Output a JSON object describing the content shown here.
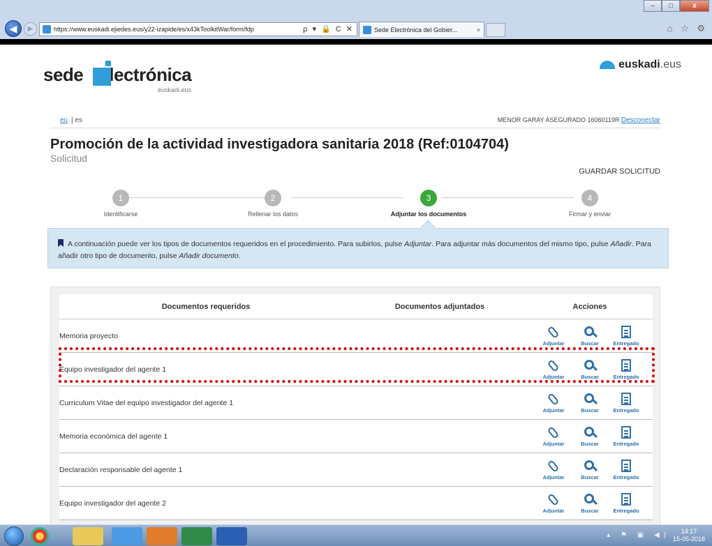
{
  "browser": {
    "url": "https://www.euskadi.ejiedes.eus/y22-izapide/es/x43kToolkitWar/form/fdp",
    "url_actions": "ρ ▾ 🔒 C ✕",
    "tab_title": "Sede Electrónica del Gobier...",
    "tab_close": "×",
    "win_min": "–",
    "win_max": "□",
    "win_close": "x",
    "chrome_icons": "⌂ ☆ ⚙"
  },
  "header": {
    "logo_sede": "sede",
    "logo_elec": "lectrónica",
    "logo_sub": "euskadi.eus",
    "euskadi_bold": "euskadi",
    "euskadi_ext": ".eus"
  },
  "langbar": {
    "lang_eu": "eu",
    "lang_sep": "| es",
    "user": "MENOR GARAY ASEGURADO 16060119R",
    "logout": "Desconectar"
  },
  "page": {
    "title": "Promoción de la actividad investigadora sanitaria 2018 (Ref:0104704)",
    "subtitle": "Solicitud",
    "save": "GUARDAR SOLICITUD"
  },
  "steps": [
    {
      "num": "1",
      "label": "Identificarse"
    },
    {
      "num": "2",
      "label": "Rellenar los datos"
    },
    {
      "num": "3",
      "label": "Adjuntar los documentos"
    },
    {
      "num": "4",
      "label": "Firmar y enviar"
    }
  ],
  "info": {
    "text1": "A continuación puede ver los tipos de documentos requeridos en el procedimiento. Para subirlos, pulse ",
    "em1": "Adjuntar",
    "text2": ". Para adjuntar más documentos del mismo tipo, pulse ",
    "em2": "Añadir",
    "text3": ". Para añadir otro tipo de documento, pulse ",
    "em3": "Añadir documento",
    "text4": "."
  },
  "table": {
    "headers": {
      "required": "Documentos requeridos",
      "attached": "Documentos adjuntados",
      "actions": "Acciones"
    },
    "action_labels": {
      "attach": "Adjuntar",
      "search": "Buscar",
      "delivered": "Entregado"
    },
    "rows": [
      {
        "name": "Memoria proyecto"
      },
      {
        "name": "Equipo investigador del agente 1"
      },
      {
        "name": "Curriculum Vitae del equipo investigador del agente 1"
      },
      {
        "name": "Memoria económica del agente 1"
      },
      {
        "name": "Declaración responsable del agente 1"
      },
      {
        "name": "Equipo investigador del agente 2"
      }
    ]
  },
  "taskbar": {
    "clock_time": "14:17",
    "clock_date": "15-05-2018"
  }
}
